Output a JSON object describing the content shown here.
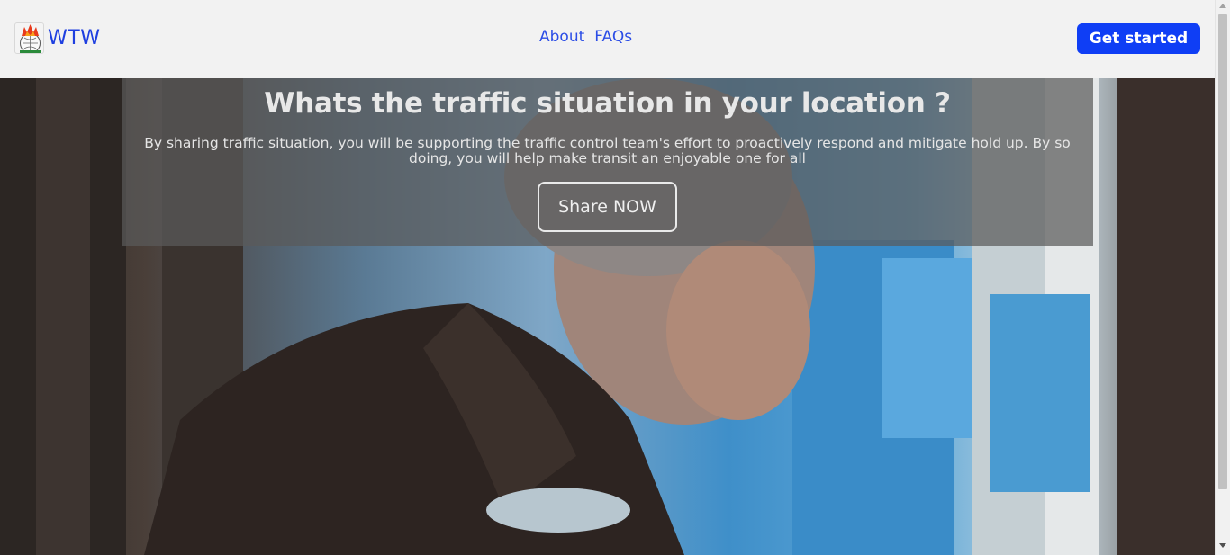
{
  "header": {
    "brand_name": "WTW",
    "nav": [
      {
        "label": "About"
      },
      {
        "label": "FAQs"
      }
    ],
    "cta_label": "Get started"
  },
  "hero": {
    "title": "Whats the traffic situation in your location ?",
    "description": "By sharing traffic situation, you will be supporting the traffic control team's effort to proactively respond and mitigate hold up. By so doing, you will help make transit an enjoyable one for all",
    "button_label": "Share NOW",
    "background_image": "man-driving-bus-photo"
  },
  "icons": {
    "logo": "flame-globe-logo-icon"
  },
  "colors": {
    "accent": "#0f3ef5",
    "link": "#2b4de6",
    "header_bg": "#f2f2f2"
  }
}
